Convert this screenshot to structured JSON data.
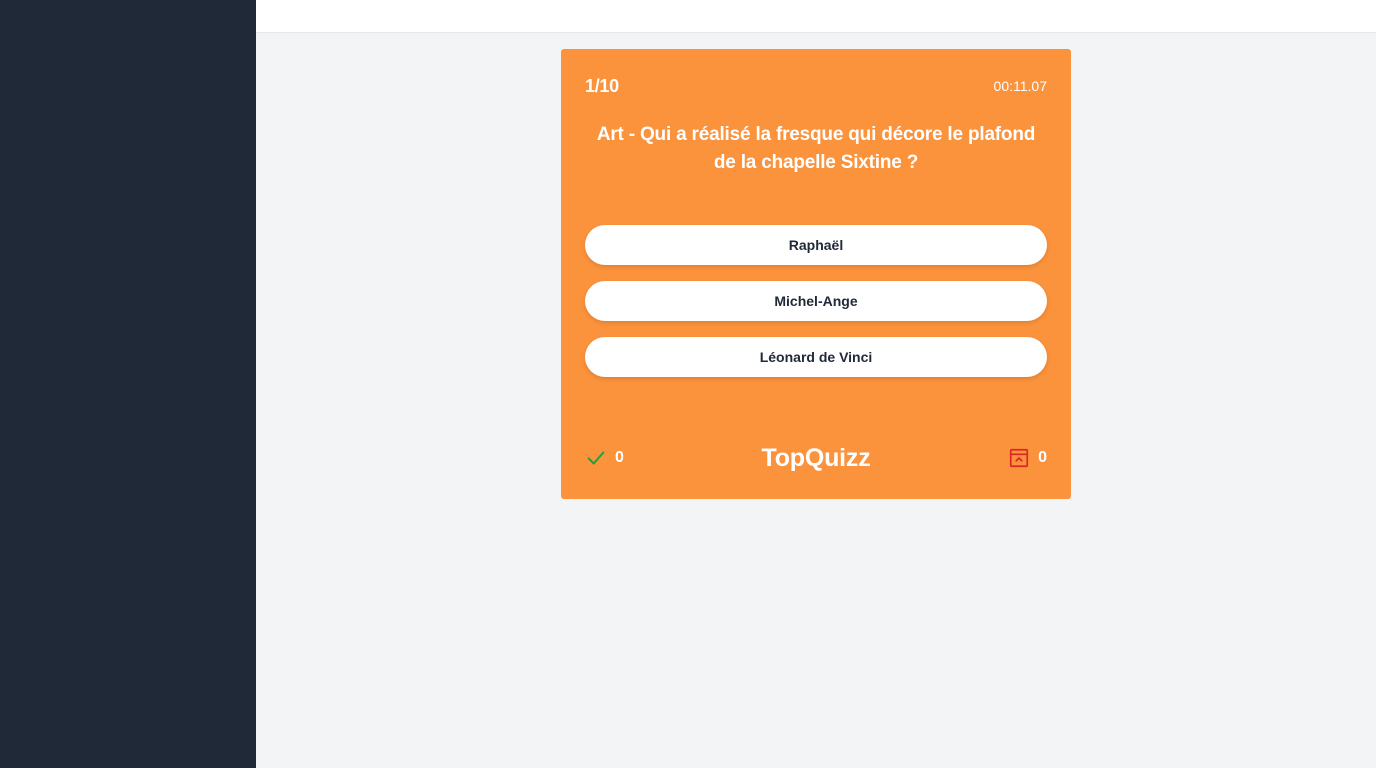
{
  "quiz": {
    "progress": "1/10",
    "timer": "00:11.07",
    "question": "Art - Qui a réalisé la fresque qui décore le plafond de la chapelle Sixtine ?",
    "answers": [
      {
        "label": "Raphaël"
      },
      {
        "label": "Michel-Ange"
      },
      {
        "label": "Léonard de Vinci"
      }
    ],
    "footer": {
      "correct_count": "0",
      "correct_icon": "checkmark-icon",
      "brand": "TopQuizz",
      "wrong_count": "0",
      "wrong_icon": "archive-box-icon"
    }
  },
  "colors": {
    "sidebar": "#1f2937",
    "card": "#fb923c",
    "correct": "#16a34a",
    "wrong": "#dc2626"
  }
}
